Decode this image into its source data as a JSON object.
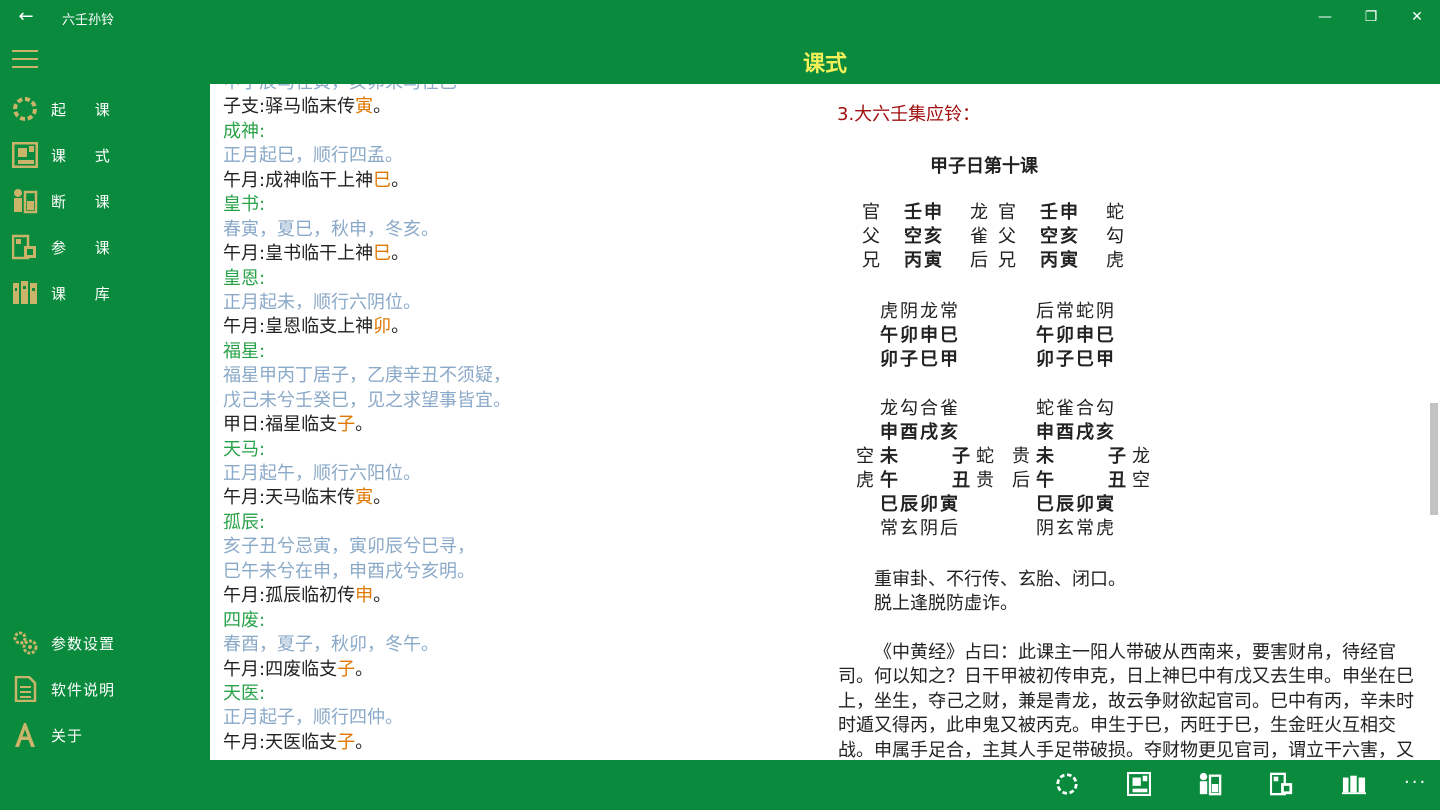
{
  "window": {
    "title": "六壬孙铃",
    "back_label": "←",
    "minimize_label": "—",
    "restore_label": "❐",
    "close_label": "✕"
  },
  "header": {
    "title": "课式",
    "menu_icon": "hamburger-icon"
  },
  "colors": {
    "brand": "#0a8a3c",
    "title_yellow": "#f4f05a",
    "heading_green": "#2aa24a",
    "verse_blue": "#8aa9c8",
    "highlight_orange": "#e07800",
    "section_red": "#a01010"
  },
  "sidebar": {
    "items": [
      {
        "label": "起 课",
        "icon": "ring-icon"
      },
      {
        "label": "课 式",
        "icon": "layout-icon"
      },
      {
        "label": "断 课",
        "icon": "figure-icon"
      },
      {
        "label": "参 课",
        "icon": "reference-icon"
      },
      {
        "label": "课 库",
        "icon": "books-icon"
      }
    ],
    "bottom_items": [
      {
        "label": "参数设置",
        "icon": "gears-icon"
      },
      {
        "label": "软件说明",
        "icon": "document-icon"
      },
      {
        "label": "关于",
        "icon": "letter-a-icon"
      }
    ]
  },
  "left": {
    "lines": [
      {
        "kind": "v",
        "text": "甲子辰马在寅，亥卯未马在巳"
      },
      {
        "kind": "t",
        "text": "子支:驿马临末传",
        "hl": "寅",
        "end": "。"
      },
      {
        "kind": "h",
        "text": "成神:"
      },
      {
        "kind": "v",
        "text": "正月起巳，顺行四孟。"
      },
      {
        "kind": "t",
        "text": "午月:成神临干上神",
        "hl": "巳",
        "end": "。"
      },
      {
        "kind": "h",
        "text": "皇书:"
      },
      {
        "kind": "v",
        "text": "春寅，夏巳，秋申，冬亥。"
      },
      {
        "kind": "t",
        "text": "午月:皇书临干上神",
        "hl": "巳",
        "end": "。"
      },
      {
        "kind": "h",
        "text": "皇恩:"
      },
      {
        "kind": "v",
        "text": "正月起未，顺行六阴位。"
      },
      {
        "kind": "t",
        "text": "午月:皇恩临支上神",
        "hl": "卯",
        "end": "。"
      },
      {
        "kind": "h",
        "text": "福星:"
      },
      {
        "kind": "v",
        "text": "福星甲丙丁居子，乙庚辛丑不须疑，"
      },
      {
        "kind": "v",
        "text": "戊己未兮壬癸巳，见之求望事皆宜。"
      },
      {
        "kind": "t",
        "text": "甲日:福星临支",
        "hl": "子",
        "end": "。"
      },
      {
        "kind": "h",
        "text": "天马:"
      },
      {
        "kind": "v",
        "text": "正月起午，顺行六阳位。"
      },
      {
        "kind": "t",
        "text": "午月:天马临末传",
        "hl": "寅",
        "end": "。"
      },
      {
        "kind": "h",
        "text": "孤辰:"
      },
      {
        "kind": "v",
        "text": "亥子丑兮忌寅，寅卯辰兮巳寻，"
      },
      {
        "kind": "v",
        "text": "巳午未兮在申，申酉戌兮亥明。"
      },
      {
        "kind": "t",
        "text": "午月:孤辰临初传",
        "hl": "申",
        "end": "。"
      },
      {
        "kind": "h",
        "text": "四废:"
      },
      {
        "kind": "v",
        "text": "春酉，夏子，秋卯，冬午。"
      },
      {
        "kind": "t",
        "text": "午月:四废临支",
        "hl": "子",
        "end": "。"
      },
      {
        "kind": "h",
        "text": "天医:"
      },
      {
        "kind": "v",
        "text": "正月起子，顺行四仲。"
      },
      {
        "kind": "t",
        "text": "午月:天医临支",
        "hl": "子",
        "end": "。"
      }
    ]
  },
  "right": {
    "section_title": "3.大六壬集应铃：",
    "lesson_title": "甲子日第十课",
    "chuan_left": [
      [
        "官",
        "壬申",
        "龙"
      ],
      [
        "父",
        "空亥",
        "雀"
      ],
      [
        "兄",
        "丙寅",
        "后"
      ]
    ],
    "chuan_right": [
      [
        "官",
        "壬申",
        "蛇"
      ],
      [
        "父",
        "空亥",
        "勾"
      ],
      [
        "兄",
        "丙寅",
        "虎"
      ]
    ],
    "ke_left": [
      "虎阴龙常",
      "午卯申巳",
      "卯子巳甲"
    ],
    "ke_right": [
      "后常蛇阴",
      "午卯申巳",
      "卯子巳甲"
    ],
    "pan_left": {
      "top_gods": "龙勾合雀",
      "top": "申酉戌亥",
      "row1": {
        "outer_l": "空",
        "l": "未",
        "r": "子",
        "outer_r": "蛇"
      },
      "row2": {
        "outer_l": "虎",
        "l": "午",
        "r": "丑",
        "outer_r": "贵"
      },
      "bottom": "巳辰卯寅",
      "bottom_gods": "常玄阴后"
    },
    "pan_right": {
      "top_gods": "蛇雀合勾",
      "top": "申酉戌亥",
      "row1": {
        "outer_l": "贵",
        "l": "未",
        "r": "子",
        "outer_r": "龙"
      },
      "row2": {
        "outer_l": "后",
        "l": "午",
        "r": "丑",
        "outer_r": "空"
      },
      "bottom": "巳辰卯寅",
      "bottom_gods": "阴玄常虎"
    },
    "gua_line1": "重审卦、不行传、玄胎、闭口。",
    "gua_line2": "脱上逢脱防虚诈。",
    "paragraph": "《中黄经》占曰：此课主一阳人带破从西南来，要害财帛，待经官司。何以知之？日干甲被初传申克，日上神巳中有戊又去生申。申坐在巳上，坐生，夺己之财，兼是青龙，故云争财欲起官司。巳中有丙，辛未时时遁又得丙，此申鬼又被丙克。申生于巳，丙旺于巳，生金旺火互相交战。申属手足合，主其人手足带破损。夺财物更见官司，谓立干六害，又"
  },
  "bottombar": {
    "icons": [
      "ring-icon",
      "layout-icon",
      "figure-icon",
      "reference-icon",
      "books-icon"
    ],
    "more_label": "···"
  }
}
